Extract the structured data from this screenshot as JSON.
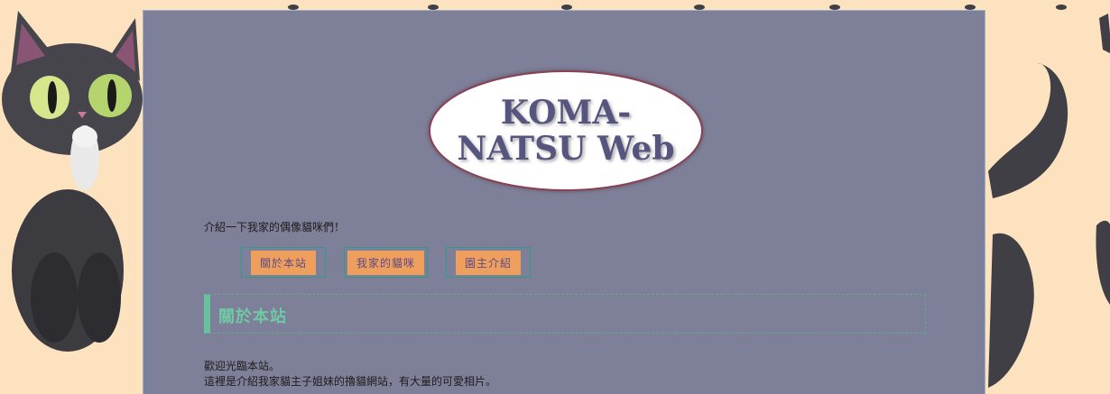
{
  "header": {
    "logo_line1": "KOMA-",
    "logo_line2": "NATSU Web"
  },
  "intro_text": "介紹一下我家的偶像貓咪們！",
  "nav": {
    "items": [
      {
        "label": "關於本站"
      },
      {
        "label": "我家的貓咪"
      },
      {
        "label": "園主介紹"
      }
    ]
  },
  "section": {
    "title": "關於本站"
  },
  "body": {
    "line1": "歡迎光臨本站。",
    "line2": "這裡是介紹我家貓主子姐妹的擼貓網站，有大量的可愛相片。"
  },
  "colors": {
    "background": "#fde2c0",
    "page": "#7e7f98",
    "nav_button": "#ef9f5d",
    "accent": "#66c19c",
    "logo_text": "#56557f"
  }
}
